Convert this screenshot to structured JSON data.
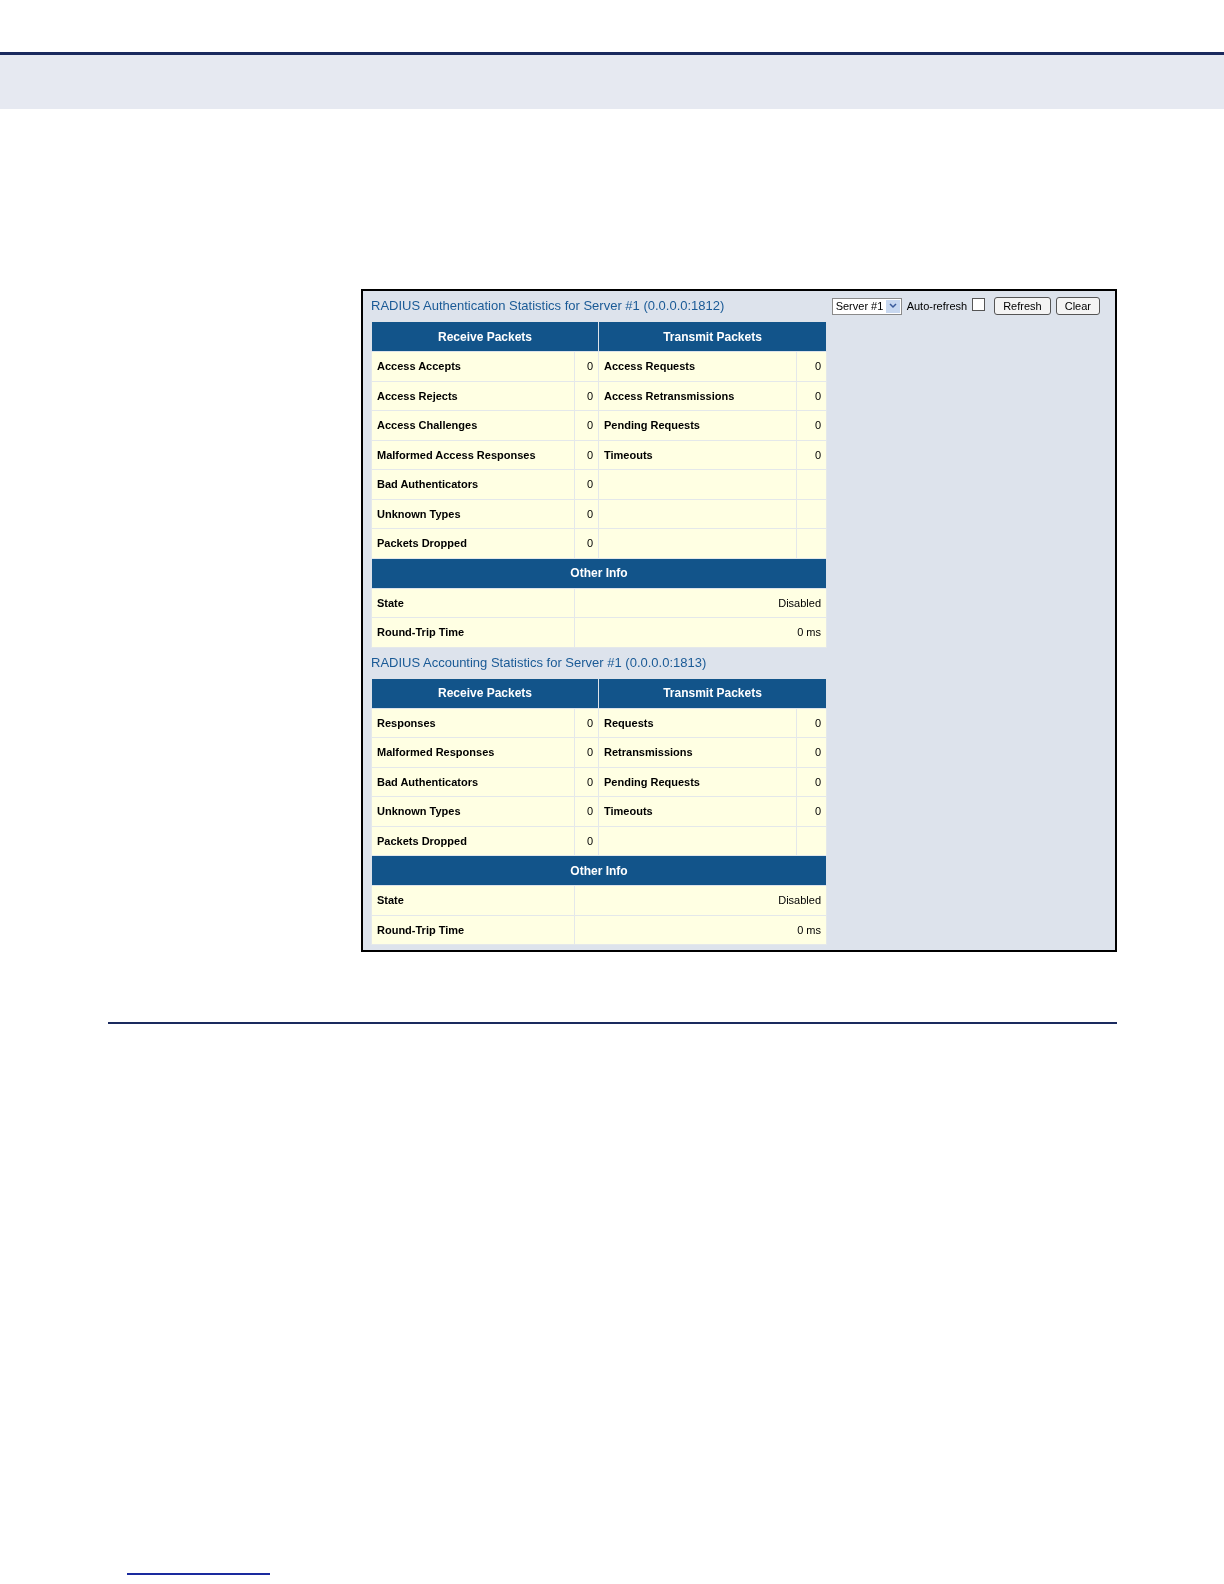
{
  "controls": {
    "server_select": "Server #1",
    "auto_refresh_label": "Auto-refresh",
    "auto_refresh_checked": false,
    "buttons": [
      "Refresh",
      "Clear"
    ]
  },
  "sections": [
    {
      "title": "RADIUS Authentication Statistics for Server #1 (0.0.0.0:1812)",
      "receive_header": "Receive Packets",
      "transmit_header": "Transmit Packets",
      "rows": [
        {
          "rx_label": "Access Accepts",
          "rx_value": "0",
          "tx_label": "Access Requests",
          "tx_value": "0"
        },
        {
          "rx_label": "Access Rejects",
          "rx_value": "0",
          "tx_label": "Access Retransmissions",
          "tx_value": "0"
        },
        {
          "rx_label": "Access Challenges",
          "rx_value": "0",
          "tx_label": "Pending Requests",
          "tx_value": "0"
        },
        {
          "rx_label": "Malformed Access Responses",
          "rx_value": "0",
          "tx_label": "Timeouts",
          "tx_value": "0"
        },
        {
          "rx_label": "Bad Authenticators",
          "rx_value": "0"
        },
        {
          "rx_label": "Unknown Types",
          "rx_value": "0"
        },
        {
          "rx_label": "Packets Dropped",
          "rx_value": "0"
        }
      ],
      "other_header": "Other Info",
      "other_rows": [
        {
          "label": "State",
          "value": "Disabled"
        },
        {
          "label": "Round-Trip Time",
          "value": "0 ms"
        }
      ]
    },
    {
      "title": "RADIUS Accounting Statistics for Server #1 (0.0.0.0:1813)",
      "receive_header": "Receive Packets",
      "transmit_header": "Transmit Packets",
      "rows": [
        {
          "rx_label": "Responses",
          "rx_value": "0",
          "tx_label": "Requests",
          "tx_value": "0"
        },
        {
          "rx_label": "Malformed Responses",
          "rx_value": "0",
          "tx_label": "Retransmissions",
          "tx_value": "0"
        },
        {
          "rx_label": "Bad Authenticators",
          "rx_value": "0",
          "tx_label": "Pending Requests",
          "tx_value": "0"
        },
        {
          "rx_label": "Unknown Types",
          "rx_value": "0",
          "tx_label": "Timeouts",
          "tx_value": "0"
        },
        {
          "rx_label": "Packets Dropped",
          "rx_value": "0"
        }
      ],
      "other_header": "Other Info",
      "other_rows": [
        {
          "label": "State",
          "value": "Disabled"
        },
        {
          "label": "Round-Trip Time",
          "value": "0 ms"
        }
      ]
    }
  ]
}
